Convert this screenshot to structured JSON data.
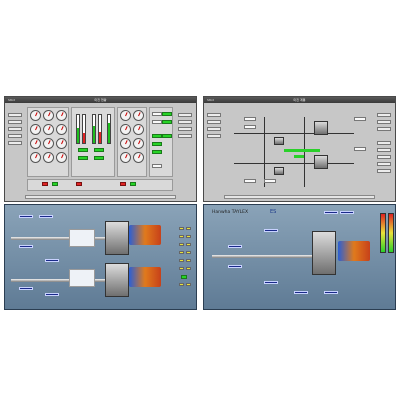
{
  "screens": {
    "top_left": {
      "title": "마진 현황",
      "corner": "Stbd"
    },
    "top_right": {
      "title": "마진 계통",
      "corner": "Stbd"
    },
    "bottom_right": {
      "brand": "Hanwha TAYLEX",
      "tag": "ES"
    }
  }
}
